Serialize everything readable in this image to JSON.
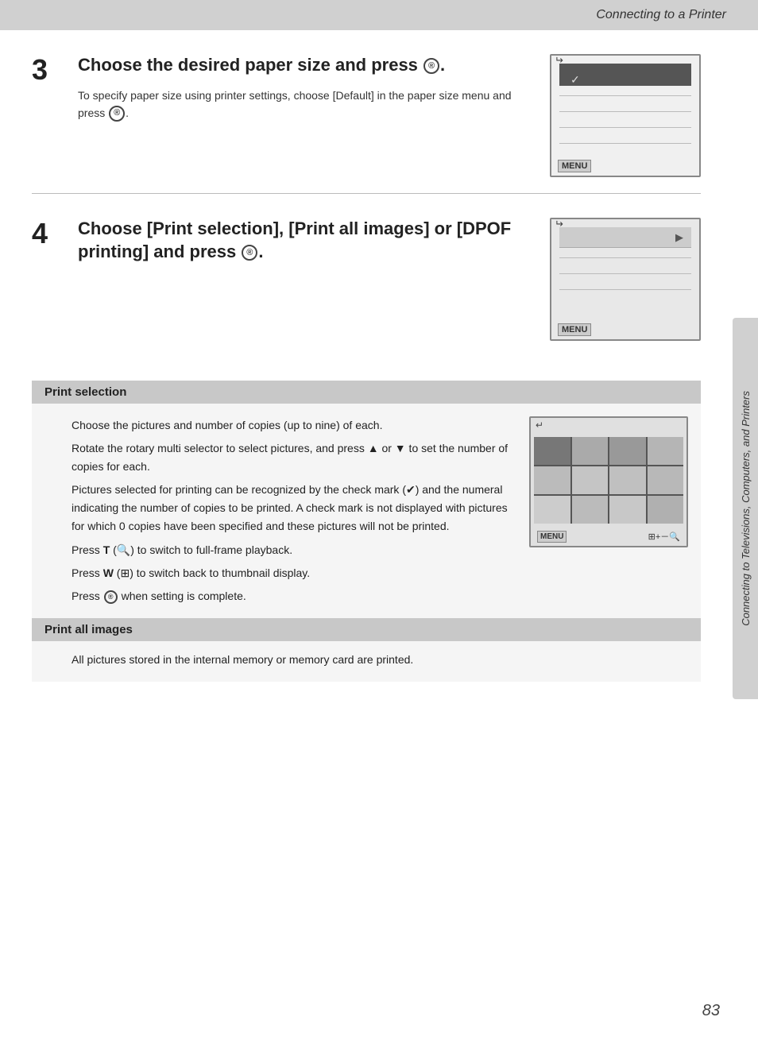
{
  "header": {
    "title": "Connecting to a Printer"
  },
  "side_tab": {
    "text": "Connecting to Televisions, Computers, and Printers"
  },
  "step3": {
    "number": "3",
    "title": "Choose the desired paper size and press ®.",
    "title_plain": "Choose the desired paper size and press",
    "body": "To specify paper size using printer settings, choose [Default] in the paper size menu and press",
    "body_suffix": "."
  },
  "step4": {
    "number": "4",
    "title_plain": "Choose [Print selection], [Print all images] or [DPOF printing] and press",
    "title_suffix": "."
  },
  "print_selection": {
    "header": "Print selection",
    "paragraphs": [
      "Choose the pictures and number of copies (up to nine) of each.",
      "Rotate the rotary multi selector to select pictures, and press ▲ or ▼ to set the number of copies for each.",
      "Pictures selected for printing can be recognized by the check mark (✔) and the numeral indicating the number of copies to be printed. A check mark is not displayed with pictures for which 0 copies have been specified and these pictures will not be printed.",
      "Press T (🔍) to switch to full-frame playback.",
      "Press W (⊞) to switch back to thumbnail display.",
      "Press ® when setting is complete."
    ]
  },
  "print_all": {
    "header": "Print all images",
    "body": "All pictures stored in the internal memory or memory card are printed."
  },
  "page_number": "83",
  "thumb_cells": [
    {
      "row": 0,
      "col": 0,
      "selected": true
    },
    {
      "row": 0,
      "col": 1,
      "selected": false
    },
    {
      "row": 0,
      "col": 2,
      "selected": false
    },
    {
      "row": 0,
      "col": 3,
      "selected": false
    },
    {
      "row": 1,
      "col": 0,
      "selected": false
    },
    {
      "row": 1,
      "col": 1,
      "selected": false
    },
    {
      "row": 1,
      "col": 2,
      "selected": false
    },
    {
      "row": 1,
      "col": 3,
      "selected": false
    },
    {
      "row": 2,
      "col": 0,
      "selected": false
    },
    {
      "row": 2,
      "col": 1,
      "selected": false
    },
    {
      "row": 2,
      "col": 2,
      "selected": false
    },
    {
      "row": 2,
      "col": 3,
      "selected": false
    }
  ]
}
